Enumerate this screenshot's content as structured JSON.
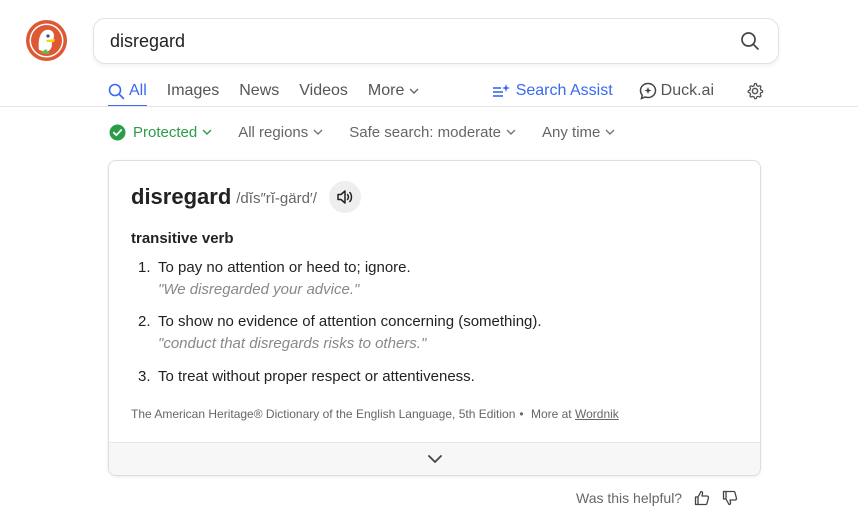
{
  "search": {
    "query": "disregard"
  },
  "tabs": [
    {
      "label": "All",
      "active": true
    },
    {
      "label": "Images"
    },
    {
      "label": "News"
    },
    {
      "label": "Videos"
    },
    {
      "label": "More"
    }
  ],
  "right_tabs": {
    "assist_label": "Search Assist",
    "duckai_label": "Duck.ai"
  },
  "filters": {
    "protected": "Protected",
    "regions": "All regions",
    "safe_search": "Safe search: moderate",
    "time": "Any time"
  },
  "definition": {
    "word": "disregard",
    "pronunciation": "/dĭs″rĭ-gärd′/",
    "part_of_speech": "transitive verb",
    "senses": [
      {
        "num": "1.",
        "text": "To pay no attention or heed to; ignore.",
        "example": "\"We disregarded your advice.\""
      },
      {
        "num": "2.",
        "text": "To show no evidence of attention concerning (something).",
        "example": "\"conduct that disregards risks to others.\""
      },
      {
        "num": "3.",
        "text": "To treat without proper respect or attentiveness.",
        "example": ""
      }
    ],
    "source": "The American Heritage® Dictionary of the English Language, 5th Edition",
    "separator": "•",
    "more_at": "More at",
    "more_link": "Wordnik"
  },
  "feedback": {
    "question": "Was this helpful?"
  },
  "colors": {
    "accent": "#3969ef",
    "protected": "#2a9d4a",
    "logo": "#de5833"
  }
}
